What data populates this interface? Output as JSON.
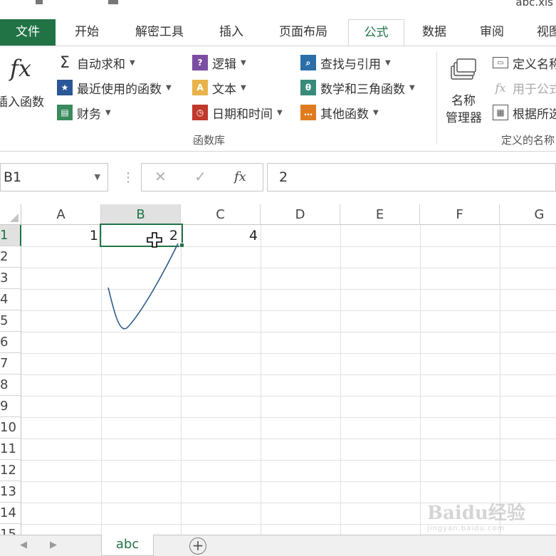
{
  "window": {
    "filename": "abc.xls"
  },
  "tabs": [
    {
      "label": "文件"
    },
    {
      "label": "开始"
    },
    {
      "label": "解密工具"
    },
    {
      "label": "插入"
    },
    {
      "label": "页面布局"
    },
    {
      "label": "公式"
    },
    {
      "label": "数据"
    },
    {
      "label": "审阅"
    },
    {
      "label": "视图"
    }
  ],
  "ribbon": {
    "insert_function": {
      "icon": "fx",
      "label": "插入函数"
    },
    "library": {
      "autosum": "自动求和",
      "recent": "最近使用的函数",
      "finance": "财务",
      "logic": "逻辑",
      "text": "文本",
      "datetime": "日期和时间",
      "lookup": "查找与引用",
      "math": "数学和三角函数",
      "other": "其他函数",
      "group_label": "函数库"
    },
    "names": {
      "manager_line1": "名称",
      "manager_line2": "管理器",
      "define": "定义名称",
      "use_in_formula": "用于公式",
      "create_from_selection": "根据所选内容创建",
      "group_label": "定义的名称"
    }
  },
  "formula_bar": {
    "name_box": "B1",
    "fx_label": "fx",
    "value": "2"
  },
  "grid": {
    "columns": [
      "A",
      "B",
      "C",
      "D",
      "E",
      "F",
      "G"
    ],
    "selected_column": "B",
    "rows": [
      "1",
      "2",
      "3",
      "4",
      "5",
      "6",
      "7",
      "8",
      "9",
      "10",
      "11",
      "12",
      "13",
      "14",
      "15"
    ],
    "selected_row": "1",
    "cells": {
      "A1": "1",
      "B1": "2",
      "C1": "4"
    },
    "active_cell": "B1"
  },
  "sheets": {
    "tabs": [
      "abc"
    ],
    "active": "abc",
    "add_label": "+"
  },
  "watermark": {
    "brand": "Baidu经验",
    "url": "jingyan.baidu.com"
  },
  "colors": {
    "accent": "#217346",
    "annotation": "#2e5c8a"
  }
}
